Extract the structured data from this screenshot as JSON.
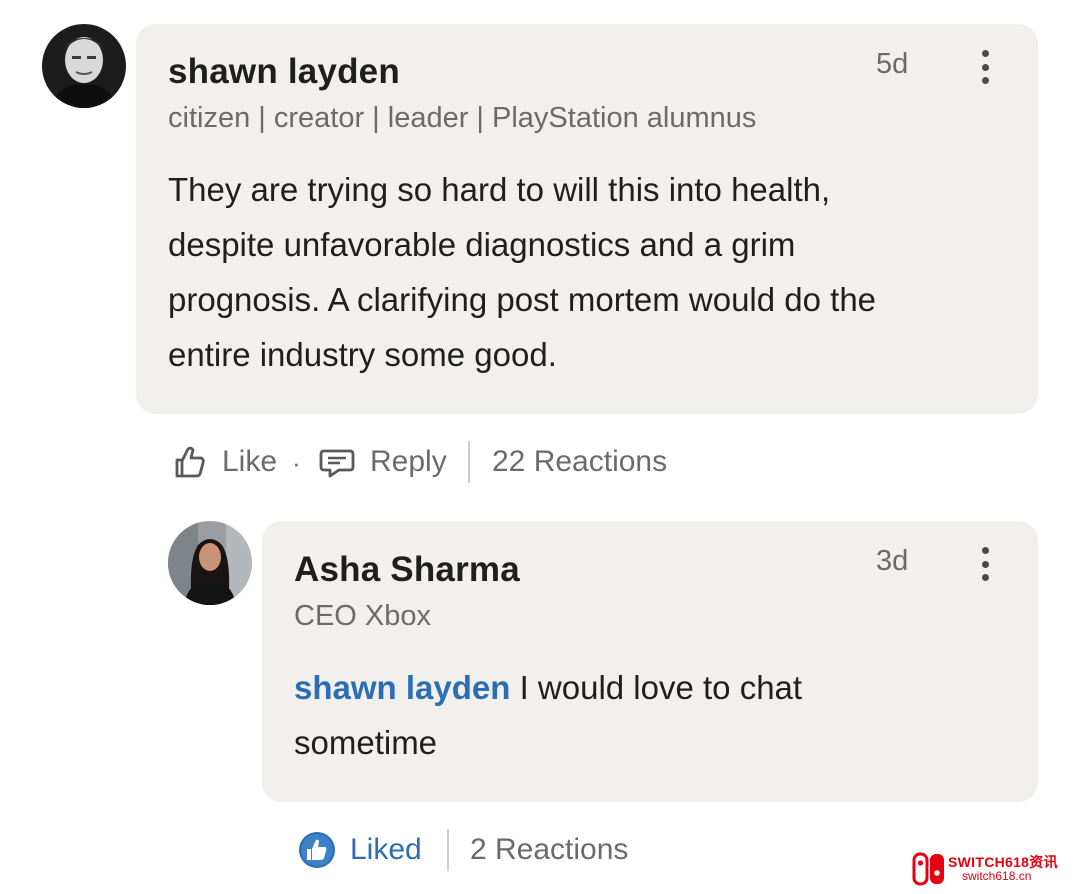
{
  "comment": {
    "author": "shawn layden",
    "headline": "citizen | creator | leader | PlayStation alumnus",
    "timestamp": "5d",
    "body_lines": [
      "They are trying so hard to will this into health,",
      "despite unfavorable diagnostics and a grim",
      "prognosis. A clarifying post mortem would do the",
      "entire industry some good."
    ],
    "actions": {
      "like_label": "Like",
      "separator": "·",
      "reply_label": "Reply",
      "reactions": "22 Reactions"
    }
  },
  "reply": {
    "author": "Asha Sharma",
    "headline": "CEO Xbox",
    "timestamp": "3d",
    "mention": "shawn layden",
    "body_rest_line1": " I would love to chat",
    "body_line2": "sometime",
    "actions": {
      "liked_label": "Liked",
      "reactions": "2 Reactions"
    }
  },
  "watermark": {
    "brand": "SWITCH618资讯",
    "site": "switch618.cn"
  },
  "colors": {
    "bubble": "#f2f0ec",
    "link": "#2c6eb3",
    "muted": "#6b6b6b",
    "text": "#1f1f1f",
    "watermark": "#e60012"
  }
}
